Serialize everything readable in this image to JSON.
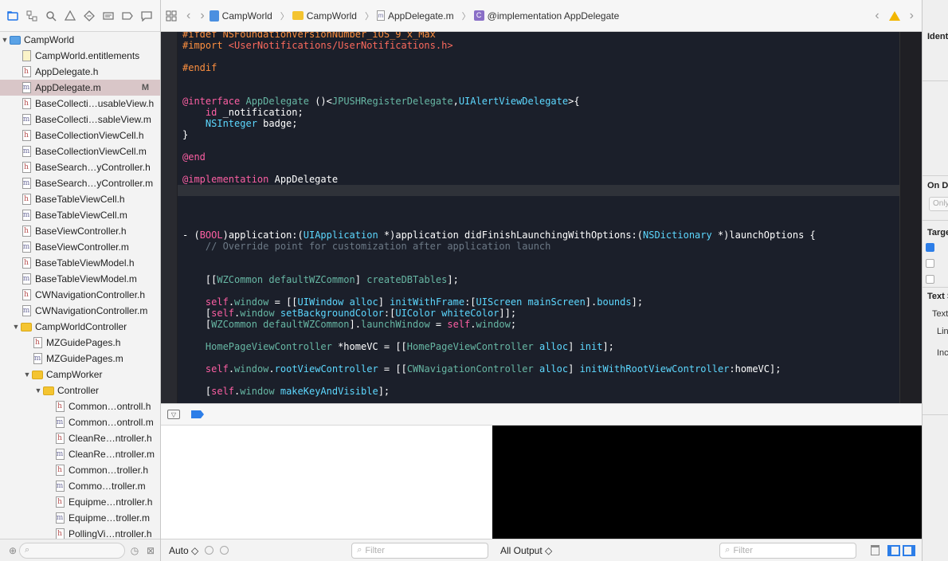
{
  "navigator": {
    "tabs": [
      "folder-icon",
      "hierarchy-icon",
      "search-icon",
      "warning-icon",
      "test-icon",
      "debug-icon",
      "breakpoint-icon",
      "report-icon"
    ],
    "tree": [
      {
        "label": "CampWorld",
        "kind": "project",
        "level": 0,
        "expanded": true
      },
      {
        "label": "CampWorld.entitlements",
        "kind": "ent",
        "level": 1
      },
      {
        "label": "AppDelegate.h",
        "kind": "h",
        "level": 1
      },
      {
        "label": "AppDelegate.m",
        "kind": "m",
        "level": 1,
        "selected": true,
        "badge": "M"
      },
      {
        "label": "BaseCollecti…usableView.h",
        "kind": "h",
        "level": 1
      },
      {
        "label": "BaseCollecti…sableView.m",
        "kind": "m",
        "level": 1
      },
      {
        "label": "BaseCollectionViewCell.h",
        "kind": "h",
        "level": 1
      },
      {
        "label": "BaseCollectionViewCell.m",
        "kind": "m",
        "level": 1
      },
      {
        "label": "BaseSearch…yController.h",
        "kind": "h",
        "level": 1
      },
      {
        "label": "BaseSearch…yController.m",
        "kind": "m",
        "level": 1
      },
      {
        "label": "BaseTableViewCell.h",
        "kind": "h",
        "level": 1
      },
      {
        "label": "BaseTableViewCell.m",
        "kind": "m",
        "level": 1
      },
      {
        "label": "BaseViewController.h",
        "kind": "h",
        "level": 1
      },
      {
        "label": "BaseViewController.m",
        "kind": "m",
        "level": 1
      },
      {
        "label": "BaseTableViewModel.h",
        "kind": "h",
        "level": 1
      },
      {
        "label": "BaseTableViewModel.m",
        "kind": "m",
        "level": 1
      },
      {
        "label": "CWNavigationController.h",
        "kind": "h",
        "level": 1
      },
      {
        "label": "CWNavigationController.m",
        "kind": "m",
        "level": 1
      },
      {
        "label": "CampWorldController",
        "kind": "folder",
        "level": 1,
        "expanded": true
      },
      {
        "label": "MZGuidePages.h",
        "kind": "h",
        "level": 2
      },
      {
        "label": "MZGuidePages.m",
        "kind": "m",
        "level": 2
      },
      {
        "label": "CampWorker",
        "kind": "folder",
        "level": 2,
        "expanded": true
      },
      {
        "label": "Controller",
        "kind": "folder",
        "level": 3,
        "expanded": true
      },
      {
        "label": "Common…ontroll.h",
        "kind": "h",
        "level": 4
      },
      {
        "label": "Common…ontroll.m",
        "kind": "m",
        "level": 4
      },
      {
        "label": "CleanRe…ntroller.h",
        "kind": "h",
        "level": 4
      },
      {
        "label": "CleanRe…ntroller.m",
        "kind": "m",
        "level": 4
      },
      {
        "label": "Common…troller.h",
        "kind": "h",
        "level": 4
      },
      {
        "label": "Commo…troller.m",
        "kind": "m",
        "level": 4
      },
      {
        "label": "Equipme…ntroller.h",
        "kind": "h",
        "level": 4
      },
      {
        "label": "Equipme…troller.m",
        "kind": "m",
        "level": 4
      },
      {
        "label": "PollingVi…ntroller.h",
        "kind": "h",
        "level": 4
      }
    ],
    "filter_placeholder": "Filter"
  },
  "jumpbar": {
    "crumbs": [
      "CampWorld",
      "CampWorld",
      "AppDelegate.m",
      "@implementation AppDelegate"
    ]
  },
  "editor": {
    "highlighted_line": 14,
    "lines": [
      {
        "tokens": [
          [
            "#ifdef NSFoundationVersionNumber_iOS_9_x_Max",
            "c-dir"
          ]
        ]
      },
      {
        "tokens": [
          [
            "#import ",
            "c-dir"
          ],
          [
            "<UserNotifications/UserNotifications.h>",
            "c-str"
          ]
        ]
      },
      {
        "tokens": []
      },
      {
        "tokens": [
          [
            "#endif",
            "c-dir"
          ]
        ]
      },
      {
        "tokens": []
      },
      {
        "tokens": []
      },
      {
        "tokens": [
          [
            "@interface",
            "c-kw"
          ],
          [
            " ",
            "c-txt"
          ],
          [
            "AppDelegate",
            "c-meth"
          ],
          [
            " ()<",
            "c-txt"
          ],
          [
            "JPUSHRegisterDelegate",
            "c-meth"
          ],
          [
            ",",
            "c-txt"
          ],
          [
            "UIAlertViewDelegate",
            "c-type"
          ],
          [
            ">{",
            "c-txt"
          ]
        ]
      },
      {
        "tokens": [
          [
            "    ",
            "c-txt"
          ],
          [
            "id",
            "c-kw"
          ],
          [
            " _notification;",
            "c-txt"
          ]
        ]
      },
      {
        "tokens": [
          [
            "    ",
            "c-txt"
          ],
          [
            "NSInteger",
            "c-type"
          ],
          [
            " badge;",
            "c-txt"
          ]
        ]
      },
      {
        "tokens": [
          [
            "}",
            "c-txt"
          ]
        ]
      },
      {
        "tokens": []
      },
      {
        "tokens": [
          [
            "@end",
            "c-kw"
          ]
        ]
      },
      {
        "tokens": []
      },
      {
        "tokens": [
          [
            "@implementation",
            "c-kw"
          ],
          [
            " AppDelegate",
            "c-txt"
          ]
        ]
      },
      {
        "tokens": []
      },
      {
        "tokens": []
      },
      {
        "tokens": []
      },
      {
        "tokens": []
      },
      {
        "tokens": [
          [
            "- (",
            "c-txt"
          ],
          [
            "BOOL",
            "c-kw"
          ],
          [
            ")application:(",
            "c-txt"
          ],
          [
            "UIApplication",
            "c-type"
          ],
          [
            " *)application didFinishLaunchingWithOptions:(",
            "c-txt"
          ],
          [
            "NSDictionary",
            "c-type"
          ],
          [
            " *)launchOptions {",
            "c-txt"
          ]
        ]
      },
      {
        "tokens": [
          [
            "    // Override point for customization after application launch",
            "c-com"
          ]
        ]
      },
      {
        "tokens": []
      },
      {
        "tokens": []
      },
      {
        "tokens": [
          [
            "    [[",
            "c-txt"
          ],
          [
            "WZCommon",
            "c-meth"
          ],
          [
            " ",
            "c-txt"
          ],
          [
            "defaultWZCommon",
            "c-meth"
          ],
          [
            "] ",
            "c-txt"
          ],
          [
            "createDBTables",
            "c-meth"
          ],
          [
            "];",
            "c-txt"
          ]
        ]
      },
      {
        "tokens": []
      },
      {
        "tokens": [
          [
            "    ",
            "c-txt"
          ],
          [
            "self",
            "c-kw"
          ],
          [
            ".",
            "c-txt"
          ],
          [
            "window",
            "c-meth"
          ],
          [
            " = [[",
            "c-txt"
          ],
          [
            "UIWindow",
            "c-type"
          ],
          [
            " ",
            "c-txt"
          ],
          [
            "alloc",
            "c-type"
          ],
          [
            "] ",
            "c-txt"
          ],
          [
            "initWithFrame",
            "c-type"
          ],
          [
            ":[",
            "c-txt"
          ],
          [
            "UIScreen",
            "c-type"
          ],
          [
            " ",
            "c-txt"
          ],
          [
            "mainScreen",
            "c-type"
          ],
          [
            "].",
            "c-txt"
          ],
          [
            "bounds",
            "c-type"
          ],
          [
            "];",
            "c-txt"
          ]
        ]
      },
      {
        "tokens": [
          [
            "    [",
            "c-txt"
          ],
          [
            "self",
            "c-kw"
          ],
          [
            ".",
            "c-txt"
          ],
          [
            "window",
            "c-meth"
          ],
          [
            " ",
            "c-txt"
          ],
          [
            "setBackgroundColor",
            "c-type"
          ],
          [
            ":[",
            "c-txt"
          ],
          [
            "UIColor",
            "c-type"
          ],
          [
            " ",
            "c-txt"
          ],
          [
            "whiteColor",
            "c-type"
          ],
          [
            "]];",
            "c-txt"
          ]
        ]
      },
      {
        "tokens": [
          [
            "    [",
            "c-txt"
          ],
          [
            "WZCommon",
            "c-meth"
          ],
          [
            " ",
            "c-txt"
          ],
          [
            "defaultWZCommon",
            "c-meth"
          ],
          [
            "].",
            "c-txt"
          ],
          [
            "launchWindow",
            "c-meth"
          ],
          [
            " = ",
            "c-txt"
          ],
          [
            "self",
            "c-kw"
          ],
          [
            ".",
            "c-txt"
          ],
          [
            "window",
            "c-meth"
          ],
          [
            ";",
            "c-txt"
          ]
        ]
      },
      {
        "tokens": []
      },
      {
        "tokens": [
          [
            "    ",
            "c-txt"
          ],
          [
            "HomePageViewController",
            "c-meth"
          ],
          [
            " *homeVC = [[",
            "c-txt"
          ],
          [
            "HomePageViewController",
            "c-meth"
          ],
          [
            " ",
            "c-txt"
          ],
          [
            "alloc",
            "c-type"
          ],
          [
            "] ",
            "c-txt"
          ],
          [
            "init",
            "c-type"
          ],
          [
            "];",
            "c-txt"
          ]
        ]
      },
      {
        "tokens": []
      },
      {
        "tokens": [
          [
            "    ",
            "c-txt"
          ],
          [
            "self",
            "c-kw"
          ],
          [
            ".",
            "c-txt"
          ],
          [
            "window",
            "c-meth"
          ],
          [
            ".",
            "c-txt"
          ],
          [
            "rootViewController",
            "c-type"
          ],
          [
            " = [[",
            "c-txt"
          ],
          [
            "CWNavigationController",
            "c-meth"
          ],
          [
            " ",
            "c-txt"
          ],
          [
            "alloc",
            "c-type"
          ],
          [
            "] ",
            "c-txt"
          ],
          [
            "initWithRootViewController",
            "c-type"
          ],
          [
            ":homeVC];",
            "c-txt"
          ]
        ]
      },
      {
        "tokens": []
      },
      {
        "tokens": [
          [
            "    [",
            "c-txt"
          ],
          [
            "self",
            "c-kw"
          ],
          [
            ".",
            "c-txt"
          ],
          [
            "window",
            "c-meth"
          ],
          [
            " ",
            "c-txt"
          ],
          [
            "makeKeyAndVisible",
            "c-type"
          ],
          [
            "];",
            "c-txt"
          ]
        ]
      }
    ]
  },
  "debug": {
    "auto_label": "Auto ◇",
    "var_filter_placeholder": "Filter",
    "output_label": "All Output ◇",
    "console_filter_placeholder": "Filter"
  },
  "inspector": {
    "headings": [
      "Ident",
      "On De",
      "Targe",
      "Text S"
    ],
    "only_placeholder": "Only",
    "text_items": [
      "Text",
      "Lin",
      "Inc"
    ]
  },
  "colors": {
    "selection": "#d9c6c8",
    "editor_bg": "#1b1f2a",
    "accent": "#2d7ee8"
  }
}
